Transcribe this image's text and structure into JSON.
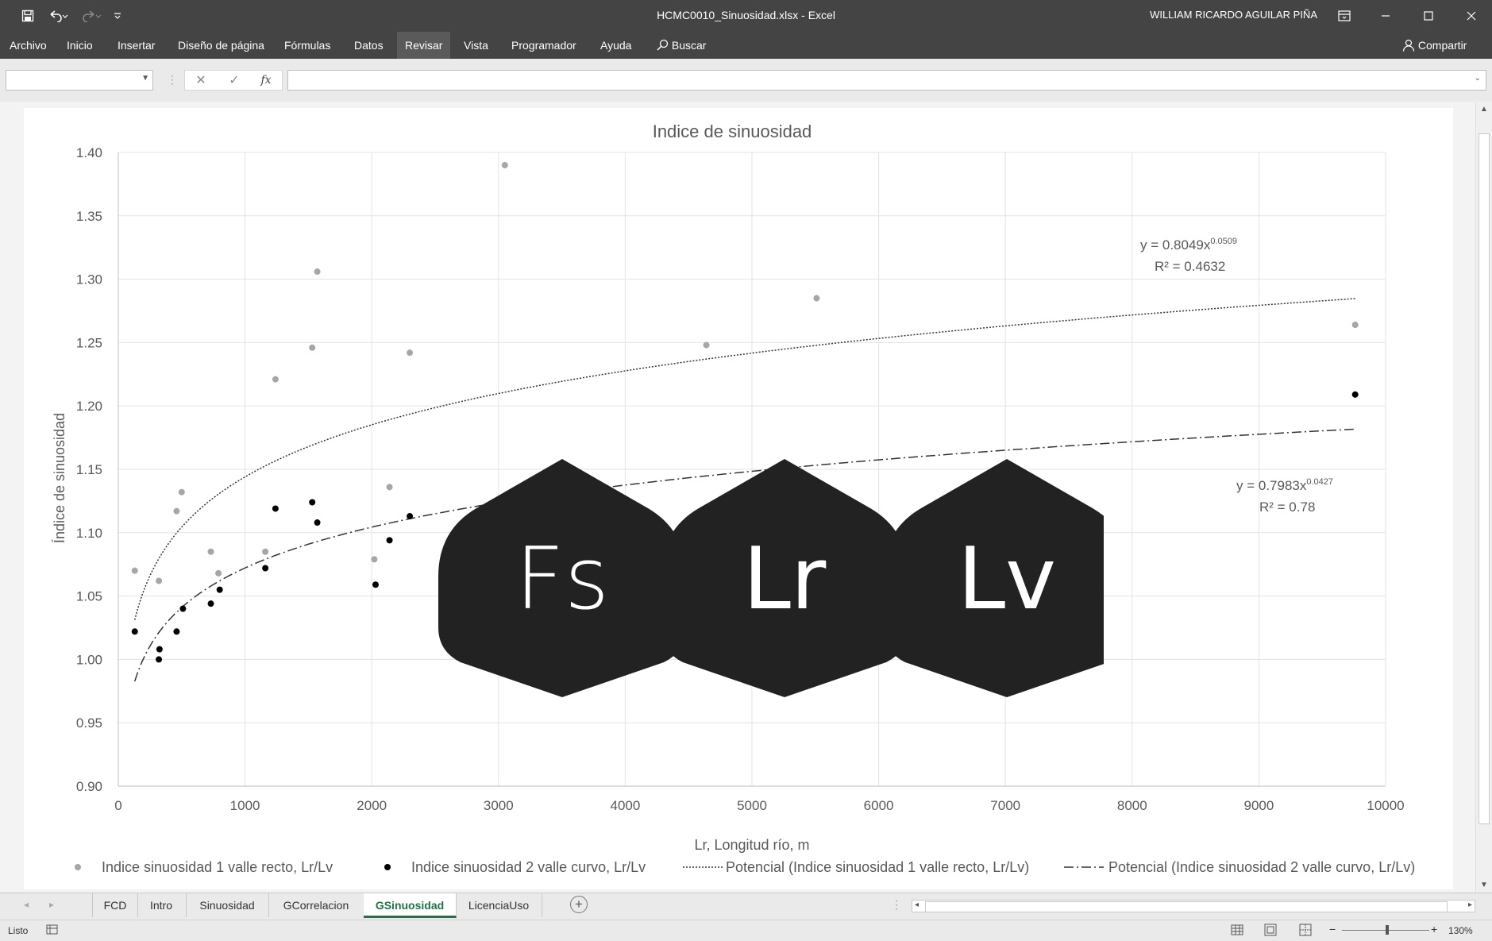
{
  "window": {
    "title": "HCMC0010_Sinuosidad.xlsx  -  Excel",
    "user": "WILLIAM RICARDO AGUILAR PIÑA",
    "quick_access": [
      "save-icon",
      "undo-icon",
      "redo-icon",
      "customize-icon"
    ]
  },
  "ribbon": {
    "tabs": [
      "Archivo",
      "Inicio",
      "Insertar",
      "Diseño de página",
      "Fórmulas",
      "Datos",
      "Revisar",
      "Vista",
      "Programador",
      "Ayuda"
    ],
    "active_tab": "Revisar",
    "search_label": "Buscar",
    "share_label": "Compartir"
  },
  "formula_bar": {
    "name_box": "",
    "content": "",
    "fx_label": "fx"
  },
  "chart_data": {
    "type": "scatter",
    "title": "Indice de sinuosidad",
    "xlabel": "Lr, Longitud río, m",
    "ylabel": "Índice de sinuosidad",
    "xlim": [
      0,
      10000
    ],
    "ylim": [
      0.9,
      1.4
    ],
    "x_ticks": [
      "0",
      "1000",
      "2000",
      "3000",
      "4000",
      "5000",
      "6000",
      "7000",
      "8000",
      "9000",
      "10000"
    ],
    "y_ticks": [
      "0.90",
      "0.95",
      "1.00",
      "1.05",
      "1.10",
      "1.15",
      "1.20",
      "1.25",
      "1.30",
      "1.35",
      "1.40"
    ],
    "grid": true,
    "legend_position": "bottom",
    "series": [
      {
        "name": "Indice sinuosidad 1 valle recto, Lr/Lv",
        "color": "#a6a6a6",
        "points": [
          [
            130,
            1.07
          ],
          [
            320,
            1.062
          ],
          [
            460,
            1.117
          ],
          [
            500,
            1.132
          ],
          [
            730,
            1.085
          ],
          [
            790,
            1.068
          ],
          [
            1160,
            1.085
          ],
          [
            1240,
            1.221
          ],
          [
            1530,
            1.246
          ],
          [
            1570,
            1.306
          ],
          [
            2020,
            1.079
          ],
          [
            2140,
            1.136
          ],
          [
            2300,
            1.242
          ],
          [
            3050,
            1.39
          ],
          [
            4640,
            1.248
          ],
          [
            5510,
            1.285
          ],
          [
            9760,
            1.264
          ]
        ]
      },
      {
        "name": "Indice sinuosidad 2 valle curvo, Lr/Lv",
        "color": "#000000",
        "points": [
          [
            130,
            1.022
          ],
          [
            320,
            1.0
          ],
          [
            325,
            1.008
          ],
          [
            460,
            1.022
          ],
          [
            510,
            1.04
          ],
          [
            730,
            1.044
          ],
          [
            800,
            1.055
          ],
          [
            1160,
            1.072
          ],
          [
            1240,
            1.119
          ],
          [
            1530,
            1.124
          ],
          [
            1570,
            1.108
          ],
          [
            2030,
            1.059
          ],
          [
            2140,
            1.094
          ],
          [
            2300,
            1.113
          ],
          [
            9760,
            1.209
          ]
        ]
      }
    ],
    "trendlines": [
      {
        "name": "Potencial (Indice sinuosidad 1 valle recto, Lr/Lv)",
        "style": "dotted",
        "a": 0.8049,
        "b": 0.0509,
        "equation": "y = 0.8049x",
        "exponent": "0.0509",
        "r2": "R² = 0.4632",
        "x_range": [
          130,
          9760
        ]
      },
      {
        "name": "Potencial (Indice sinuosidad 2 valle curvo, Lr/Lv)",
        "style": "dashdot",
        "a": 0.7983,
        "b": 0.0427,
        "equation": "y = 0.7983x",
        "exponent": "0.0427",
        "r2": "R² = 0.78",
        "x_range": [
          130,
          9760
        ]
      }
    ]
  },
  "overlay": {
    "hexagons": [
      "Fs",
      "Lr",
      "Lv"
    ],
    "color": "#222222"
  },
  "sheet_tabs": {
    "tabs": [
      "FCD",
      "Intro",
      "Sinuosidad",
      "GCorrelacion",
      "GSinuosidad",
      "LicenciaUso"
    ],
    "active": "GSinuosidad"
  },
  "status": {
    "ready": "Listo",
    "zoom": "130%"
  }
}
